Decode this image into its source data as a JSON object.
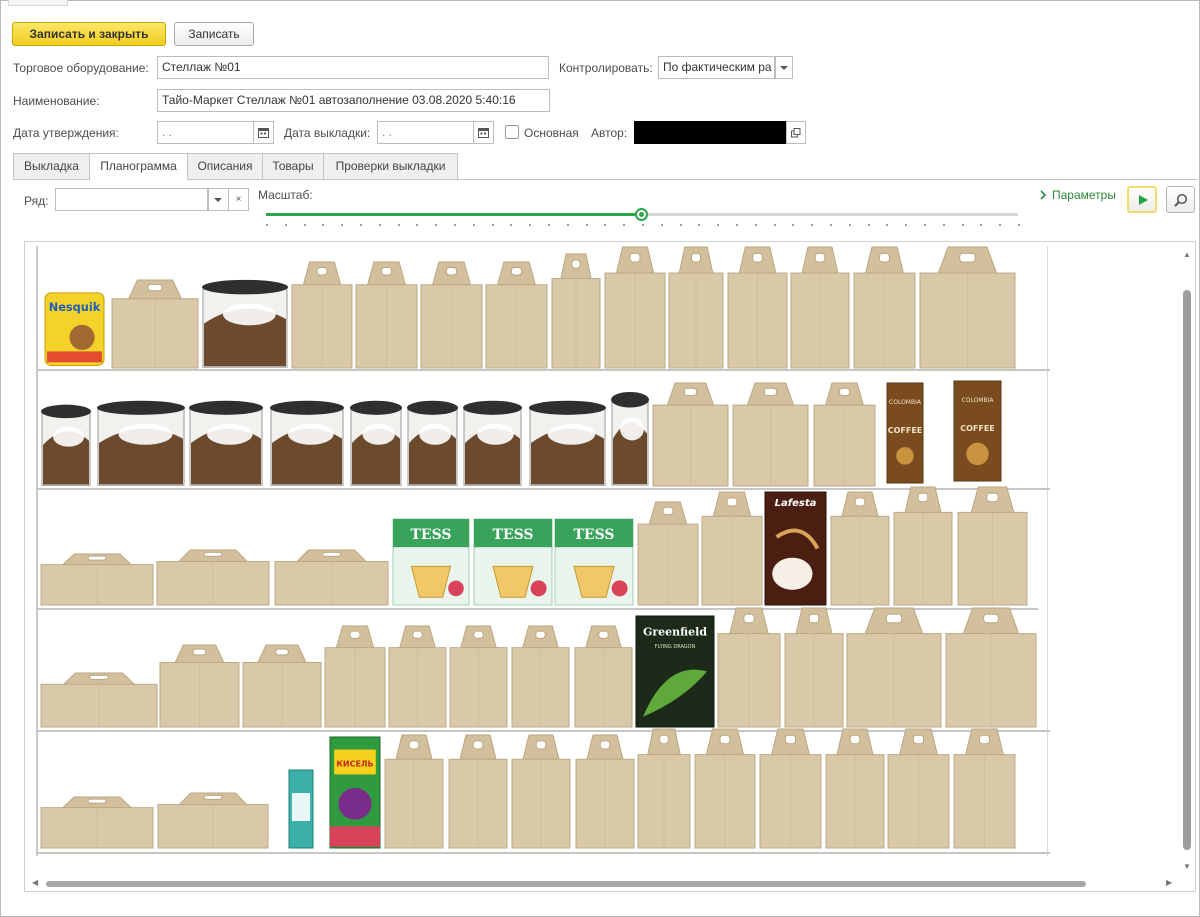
{
  "toolbar": {
    "save_close_label": "Записать и закрыть",
    "save_label": "Записать"
  },
  "form": {
    "equipment_label": "Торговое оборудование:",
    "equipment_value": "Стеллаж №01",
    "control_label": "Контролировать:",
    "control_value": "По фактическим ра",
    "name_label": "Наименование:",
    "name_value": "Тайо-Маркет Стеллаж №01 автозаполнение 03.08.2020 5:40:16",
    "approval_date_label": "Дата утверждения:",
    "approval_date_value": " .  .",
    "layout_date_label": "Дата выкладки:",
    "layout_date_value": " .  .",
    "main_label": "Основная",
    "author_label": "Автор:"
  },
  "tabs": [
    {
      "label": "Выкладка"
    },
    {
      "label": "Планограмма"
    },
    {
      "label": "Описания"
    },
    {
      "label": "Товары"
    },
    {
      "label": "Проверки выкладки"
    }
  ],
  "planogram": {
    "row_label": "Ряд:",
    "row_value": "",
    "scale_label": "Масштаб:",
    "scale_value": 0.5,
    "params_label": "Параметры"
  },
  "shelves": [
    {
      "items": [
        "Nesquik",
        "box",
        "coffee-tin",
        "box",
        "box",
        "box",
        "box",
        "box",
        "box",
        "box",
        "box",
        "box",
        "box",
        "box"
      ]
    },
    {
      "items": [
        "coffee-tin",
        "coffee-tin",
        "coffee-tin",
        "coffee-tin",
        "coffee-tin",
        "coffee-tin",
        "coffee-tin",
        "coffee-tin",
        "coffee-tin",
        "box",
        "box",
        "box",
        "coffee-bag",
        "coffee-bag"
      ]
    },
    {
      "items": [
        "box",
        "box",
        "box",
        "TESS",
        "TESS",
        "TESS",
        "box",
        "box",
        "Lafesta",
        "box",
        "box",
        "box"
      ]
    },
    {
      "items": [
        "box",
        "box",
        "box",
        "box",
        "box",
        "box",
        "box",
        "box",
        "Greenfield",
        "box",
        "box",
        "box",
        "box"
      ]
    },
    {
      "items": [
        "box",
        "box",
        "small-pack",
        "kissel",
        "box",
        "box",
        "box",
        "box",
        "box",
        "box",
        "box",
        "box",
        "box",
        "box"
      ]
    }
  ],
  "brands": {
    "nesquik": "Nesquik",
    "tess": "TESS",
    "lafesta": "Lafesta",
    "greenfield": "Greenfield",
    "greenfield_sub": "FLYING DRAGON",
    "coffee_brand": "COLOMBIA",
    "coffee_word": "COFFEE",
    "kissel": "КИСЕЛЬ"
  },
  "colors": {
    "accent_yellow": "#f2cd1b",
    "slider_green": "#2aa64b",
    "cardboard": "#d9c9a8",
    "nesquik_yellow": "#f4d22a",
    "tess_green": "#3aa35b",
    "greenfield_dark": "#1d2a1a"
  }
}
